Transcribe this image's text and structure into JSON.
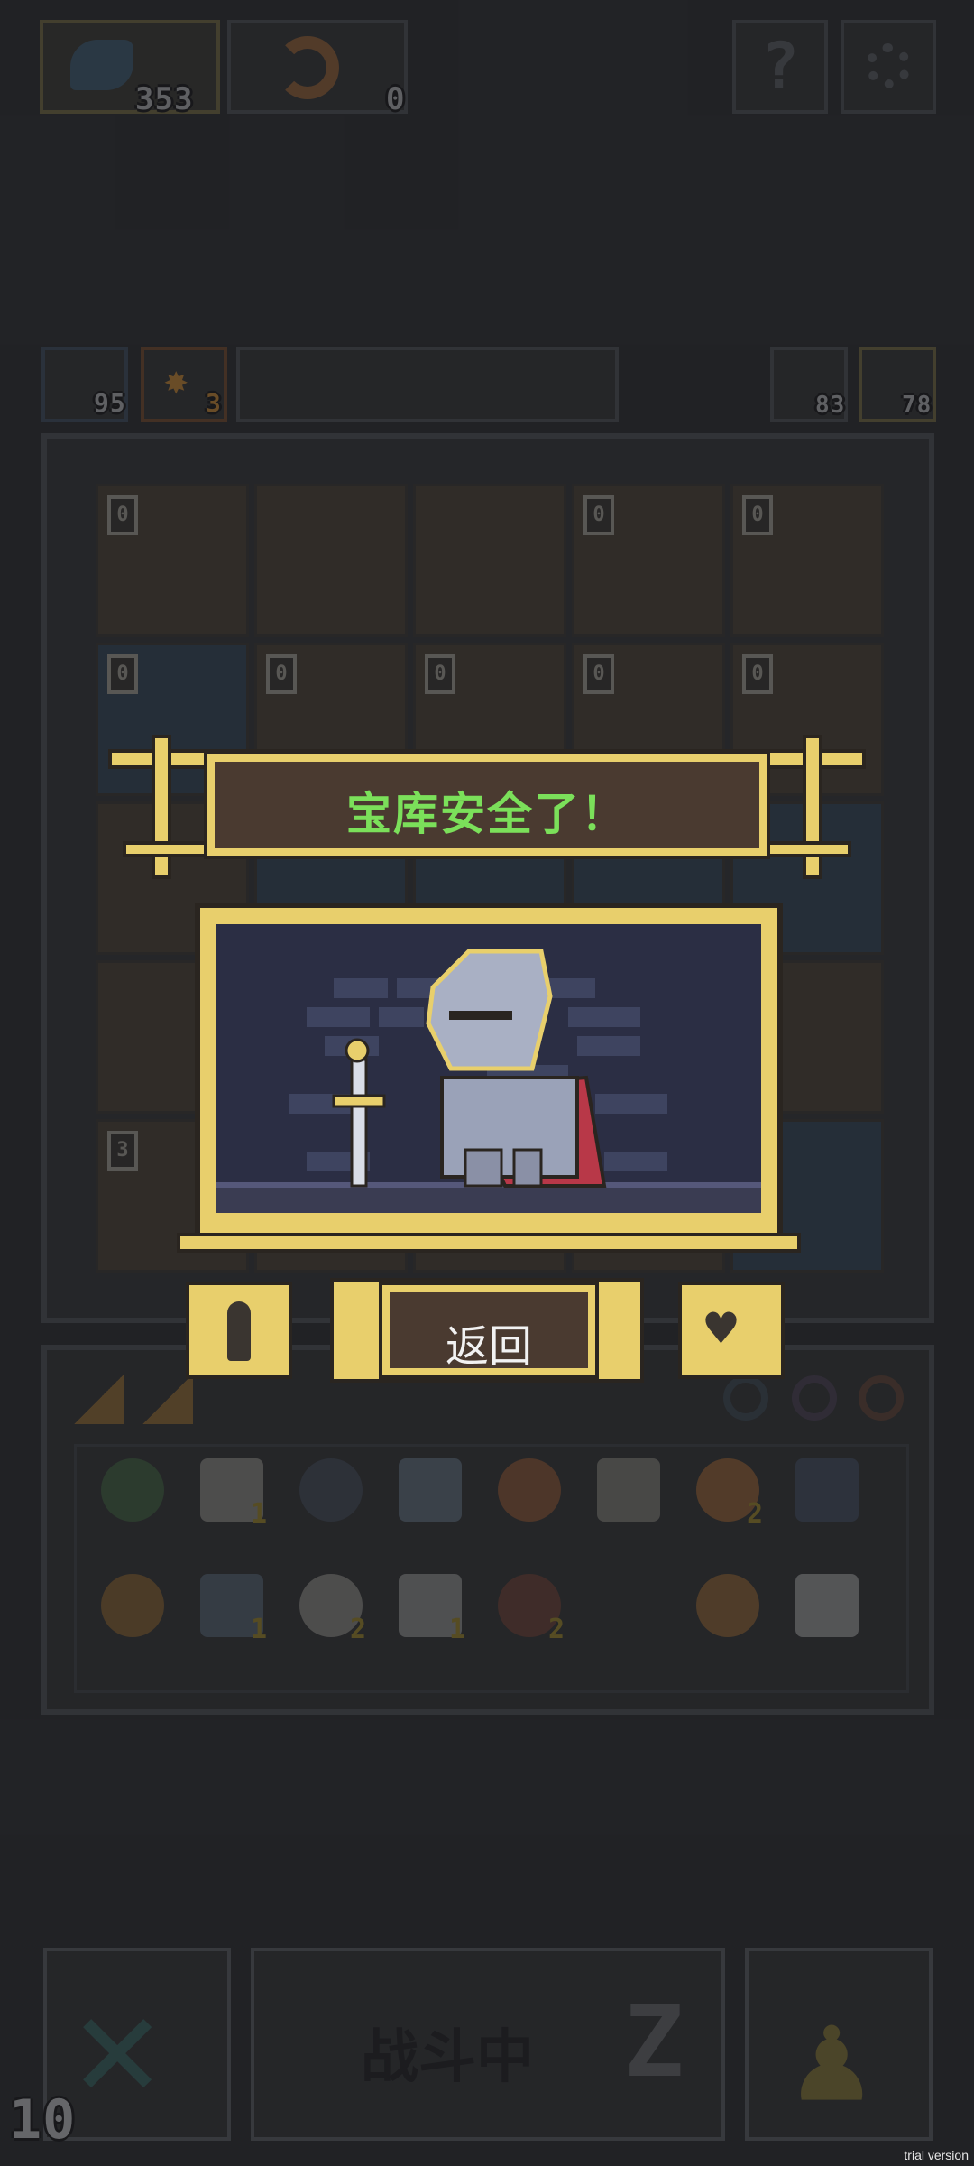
{
  "hud": {
    "currency1": {
      "icon": "blue-fish-icon",
      "value": "353"
    },
    "currency2": {
      "icon": "orange-croissant-icon",
      "value": "0"
    },
    "help_icon": "question-icon",
    "settings_icon": "gear-icon"
  },
  "status": {
    "blue_count": "95",
    "orange_count": "3",
    "right1": "83",
    "right2": "78"
  },
  "banner": {
    "title": "宝库安全了！"
  },
  "buttons": {
    "back_label": "返回"
  },
  "grid": {
    "levels": [
      "0",
      "",
      "",
      "0",
      "0",
      "0",
      "0",
      "0",
      "0",
      "0",
      "",
      "",
      "",
      "",
      "",
      "",
      "",
      "",
      "",
      "",
      "3",
      "",
      "",
      "",
      ""
    ]
  },
  "inventory": {
    "row1": [
      {
        "icon": "green-potion-icon",
        "count": ""
      },
      {
        "icon": "bone-icon",
        "count": "1"
      },
      {
        "icon": "shield-icon",
        "count": ""
      },
      {
        "icon": "chain-icon",
        "count": ""
      },
      {
        "icon": "fireball-icon",
        "count": ""
      },
      {
        "icon": "stone-icon",
        "count": ""
      },
      {
        "icon": "croissant-icon",
        "count": "2"
      },
      {
        "icon": "fish-icon",
        "count": ""
      }
    ],
    "row2": [
      {
        "icon": "map-icon",
        "count": ""
      },
      {
        "icon": "rock-icon",
        "count": "1"
      },
      {
        "icon": "cloud-icon",
        "count": "2"
      },
      {
        "icon": "anvil-icon",
        "count": "1"
      },
      {
        "icon": "magnifier-icon",
        "count": "2"
      },
      {
        "icon": "empty-slot",
        "count": ""
      },
      {
        "icon": "bread-icon",
        "count": ""
      },
      {
        "icon": "crystal-icon",
        "count": ""
      }
    ]
  },
  "bottom": {
    "turn_counter": "10",
    "fighting_label": "战斗中",
    "sleep_icon": "z-icon",
    "close_icon": "x-icon",
    "pawn_icon": "pawn-icon"
  },
  "watermark": "trial version"
}
